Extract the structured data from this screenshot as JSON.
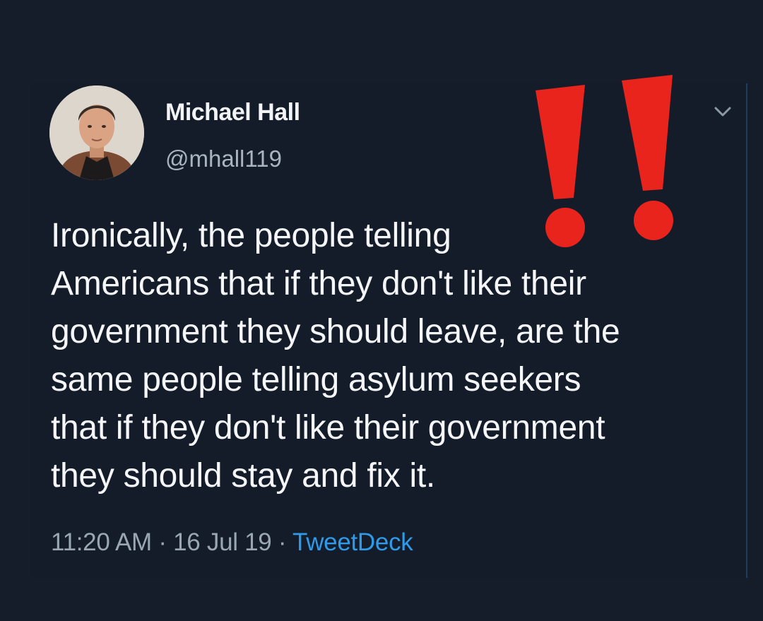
{
  "tweet": {
    "display_name": "Michael Hall",
    "handle": "@mhall119",
    "text": "Ironically, the people telling\nAmericans that if they don't like their\ngovernment they should leave, are the\nsame people telling asylum seekers\nthat if they don't like their government\nthey should stay and fix it.",
    "time": "11:20 AM",
    "separator": " · ",
    "date": "16 Jul 19",
    "source": "TweetDeck"
  },
  "icons": {
    "menu": "chevron-down-icon",
    "overlay": "double-exclamation-icon",
    "avatar": "avatar"
  },
  "colors": {
    "background": "#151c2a",
    "text": "#f4f6f8",
    "muted": "#9aa6b2",
    "link": "#2e9ae8",
    "exclamation": "#e8241c"
  }
}
